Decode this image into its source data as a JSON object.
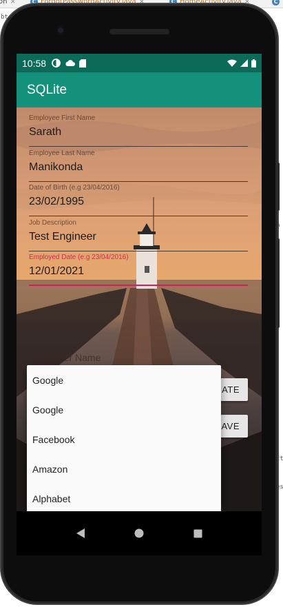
{
  "ide": {
    "tabs": [
      {
        "label": "on",
        "icon": "c-class-icon",
        "close": "×"
      },
      {
        "label": "ForgotPasswordActivity.java",
        "icon": "c-class-icon",
        "close": "×"
      },
      {
        "label": "HomeActivity.java",
        "icon": "c-class-icon",
        "close": "×"
      }
    ],
    "left_text_1": "bt",
    "right_text_1": "e",
    "right_text_2": "a",
    "right_text_3": "ct",
    "right_text_4": "es"
  },
  "status_bar": {
    "time": "10:58",
    "left_icons": [
      "sync-icon",
      "cloud-icon",
      "sd-card-icon"
    ],
    "right_icons": [
      "wifi-icon",
      "signal-icon",
      "battery-icon"
    ],
    "color": "#0b6b58"
  },
  "app_bar": {
    "title": "SQLite",
    "color": "#14917a"
  },
  "form": {
    "first_name": {
      "label": "Employee First Name",
      "value": "Sarath"
    },
    "last_name": {
      "label": "Employee Last Name",
      "value": "Manikonda"
    },
    "dob": {
      "label": "Date of Birth (e.g 23/04/2016)",
      "value": "23/02/1995"
    },
    "job": {
      "label": "Job Description",
      "value": "Test Engineer"
    },
    "employed": {
      "label": "Employed Date (e.g 23/04/2016)",
      "value": "12/01/2021"
    },
    "employer_hint": "Employer Name",
    "update_button": "DATE",
    "save_button": "AVE",
    "accent": "#d81b60"
  },
  "dropdown": {
    "options": [
      "Google",
      "Google",
      "Facebook",
      "Amazon",
      "Alphabet"
    ]
  },
  "nav": {
    "icons": [
      "back-icon",
      "home-icon",
      "recents-icon"
    ]
  }
}
